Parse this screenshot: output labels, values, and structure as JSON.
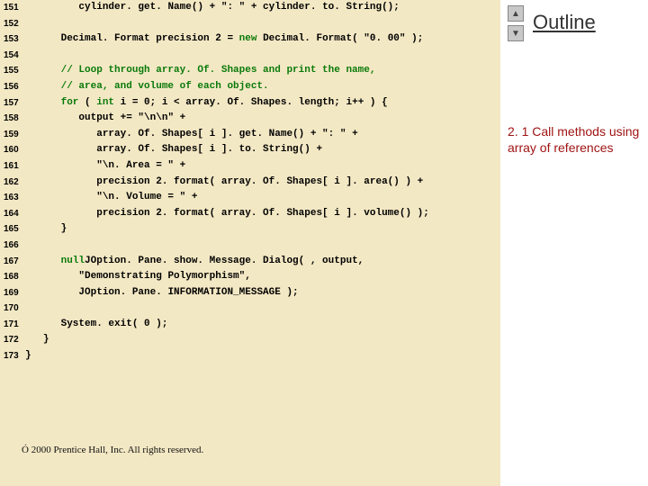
{
  "code": {
    "lines": [
      {
        "n": "151",
        "indent": "         ",
        "text": "cylinder. get. Name() + \": \" + cylinder. to. String();"
      },
      {
        "n": "152",
        "indent": "",
        "text": ""
      },
      {
        "n": "153",
        "indent": "      ",
        "text": "Decimal. Format precision 2 = ",
        "tail_kw": "new",
        "tail": " Decimal. Format( \"0. 00\" );"
      },
      {
        "n": "154",
        "indent": "",
        "text": ""
      },
      {
        "n": "155",
        "indent": "      ",
        "comment": "// Loop through array. Of. Shapes and print the name,"
      },
      {
        "n": "156",
        "indent": "      ",
        "comment": "// area, and volume of each object."
      },
      {
        "n": "157",
        "indent": "      ",
        "kw": "for",
        "text": " ( ",
        "kw2": "int",
        "text2": " i = 0; i < array. Of. Shapes. length; i++ ) {"
      },
      {
        "n": "158",
        "indent": "         ",
        "text": "output += \"\\n\\n\" +"
      },
      {
        "n": "159",
        "indent": "            ",
        "text": "array. Of. Shapes[ i ]. get. Name() + \": \" +"
      },
      {
        "n": "160",
        "indent": "            ",
        "text": "array. Of. Shapes[ i ]. to. String() +"
      },
      {
        "n": "161",
        "indent": "            ",
        "text": "\"\\n. Area = \" +"
      },
      {
        "n": "162",
        "indent": "            ",
        "text": "precision 2. format( array. Of. Shapes[ i ]. area() ) +"
      },
      {
        "n": "163",
        "indent": "            ",
        "text": "\"\\n. Volume = \" +"
      },
      {
        "n": "164",
        "indent": "            ",
        "text": "precision 2. format( array. Of. Shapes[ i ]. volume() );"
      },
      {
        "n": "165",
        "indent": "      ",
        "text": "}  "
      },
      {
        "n": "166",
        "indent": "",
        "text": ""
      },
      {
        "n": "167",
        "indent": "      ",
        "text": "JOption. Pane. show. Message. Dialog( ",
        "kw": "null",
        "text2": ", output,"
      },
      {
        "n": "168",
        "indent": "         ",
        "text": "\"Demonstrating Polymorphism\","
      },
      {
        "n": "169",
        "indent": "         ",
        "text": "JOption. Pane. INFORMATION_MESSAGE );"
      },
      {
        "n": "170",
        "indent": "",
        "text": ""
      },
      {
        "n": "171",
        "indent": "      ",
        "text": "System. exit( 0 );"
      },
      {
        "n": "172",
        "indent": "   ",
        "text": "}"
      },
      {
        "n": "173",
        "indent": "",
        "text": "}"
      }
    ]
  },
  "outline": {
    "title": "Outline",
    "up_glyph": "▲",
    "down_glyph": "▼"
  },
  "annotation": {
    "text": "2. 1 Call methods using array of references"
  },
  "footer": {
    "text": "Ó 2000 Prentice Hall, Inc. All rights reserved."
  }
}
